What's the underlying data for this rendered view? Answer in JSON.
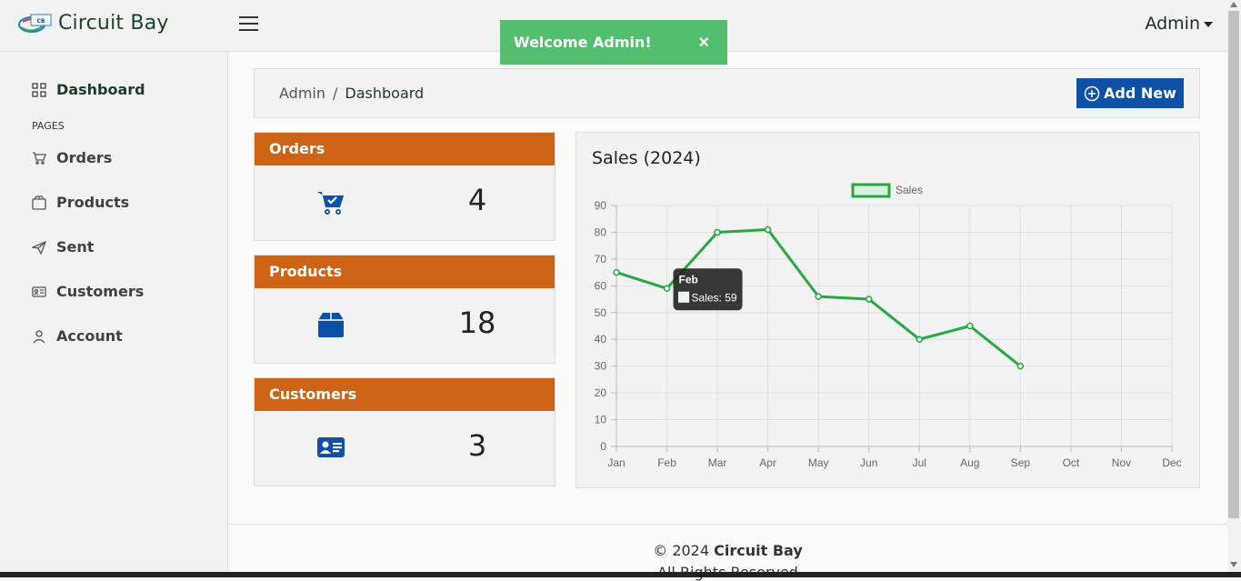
{
  "app": {
    "name": "Circuit Bay",
    "logo_text": "CIRCUIT BAY"
  },
  "header": {
    "user_menu_label": "Admin"
  },
  "toast": {
    "message": "Welcome Admin!",
    "close_label": "×"
  },
  "sidebar": {
    "section_label": "PAGES",
    "items": [
      {
        "label": "Dashboard",
        "icon": "grid-icon",
        "active": true
      },
      {
        "label": "Orders",
        "icon": "cart-icon"
      },
      {
        "label": "Products",
        "icon": "box-icon"
      },
      {
        "label": "Sent",
        "icon": "send-icon"
      },
      {
        "label": "Customers",
        "icon": "id-card-icon"
      },
      {
        "label": "Account",
        "icon": "user-icon"
      }
    ]
  },
  "breadcrumb": {
    "root": "Admin",
    "separator": "/",
    "current": "Dashboard"
  },
  "add_button": {
    "label": "Add New"
  },
  "cards": [
    {
      "title": "Orders",
      "value": "4",
      "icon": "cart-check-icon"
    },
    {
      "title": "Products",
      "value": "18",
      "icon": "box-icon"
    },
    {
      "title": "Customers",
      "value": "3",
      "icon": "id-card-icon"
    }
  ],
  "chart_data": {
    "type": "line",
    "title": "Sales (2024)",
    "categories": [
      "Jan",
      "Feb",
      "Mar",
      "Apr",
      "May",
      "Jun",
      "Jul",
      "Aug",
      "Sep",
      "Oct",
      "Nov",
      "Dec"
    ],
    "series": [
      {
        "name": "Sales",
        "values": [
          65,
          59,
          80,
          81,
          56,
          55,
          40,
          45,
          30,
          null,
          null,
          null
        ]
      }
    ],
    "ylim": [
      0,
      90
    ],
    "yticks": [
      0,
      10,
      20,
      30,
      40,
      50,
      60,
      70,
      80,
      90
    ],
    "grid": true,
    "legend": "top",
    "tooltip": {
      "title": "Feb",
      "label": "Sales: 59"
    },
    "colors": {
      "line": "#28a745",
      "tooltip_bg": "#222222"
    }
  },
  "footer": {
    "copyright_prefix": "© 2024",
    "brand": "Circuit Bay",
    "rights": "All Rights Reserved"
  },
  "colors": {
    "card_header": "#cd6314",
    "primary_button": "#0d50a6",
    "toast": "#52be6e",
    "icon_blue": "#0d50a6"
  }
}
